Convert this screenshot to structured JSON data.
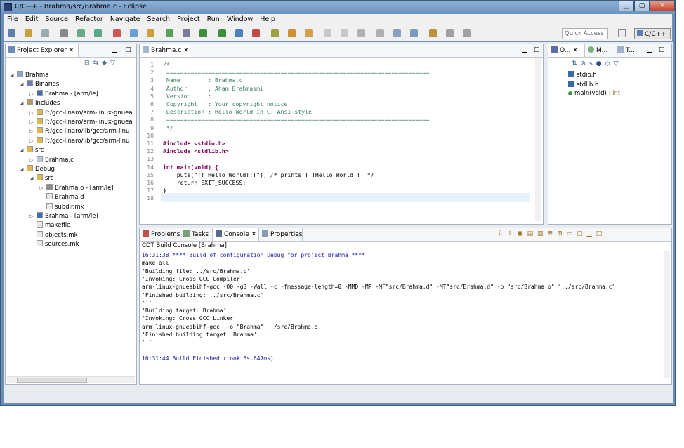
{
  "window": {
    "title": "C/C++ - Brahma/src/Brahma.c - Eclipse"
  },
  "menu": [
    "File",
    "Edit",
    "Source",
    "Refactor",
    "Navigate",
    "Search",
    "Project",
    "Run",
    "Window",
    "Help"
  ],
  "toolbar": {
    "quick_access": "Quick Access",
    "perspective": "C/C++"
  },
  "explorer": {
    "tab": "Project Explorer",
    "items": [
      {
        "label": "Brahma",
        "depth": 0,
        "icon": "project-icon"
      },
      {
        "label": "Binaries",
        "depth": 1,
        "icon": "binaries-icon"
      },
      {
        "label": "Brahma - [arm/le]",
        "depth": 2,
        "icon": "binary-icon"
      },
      {
        "label": "Includes",
        "depth": 1,
        "icon": "includes-icon"
      },
      {
        "label": "F:/gcc-linaro/arm-linux-gnuea",
        "depth": 2,
        "icon": "folder-icon"
      },
      {
        "label": "F:/gcc-linaro/arm-linux-gnuea",
        "depth": 2,
        "icon": "folder-icon"
      },
      {
        "label": "F:/gcc-linaro/lib/gcc/arm-linu",
        "depth": 2,
        "icon": "folder-icon"
      },
      {
        "label": "F:/gcc-linaro/lib/gcc/arm-linu",
        "depth": 2,
        "icon": "folder-icon"
      },
      {
        "label": "src",
        "depth": 1,
        "icon": "source-folder-icon"
      },
      {
        "label": "Brahma.c",
        "depth": 2,
        "icon": "c-file-icon"
      },
      {
        "label": "Debug",
        "depth": 1,
        "icon": "folder-icon"
      },
      {
        "label": "src",
        "depth": 2,
        "icon": "folder-icon"
      },
      {
        "label": "Brahma.o - [arm/le]",
        "depth": 3,
        "icon": "object-file-icon"
      },
      {
        "label": "Brahma.d",
        "depth": 3,
        "icon": "file-icon"
      },
      {
        "label": "subdir.mk",
        "depth": 3,
        "icon": "file-icon"
      },
      {
        "label": "Brahma - [arm/le]",
        "depth": 2,
        "icon": "binary-icon"
      },
      {
        "label": "makefile",
        "depth": 2,
        "icon": "file-icon"
      },
      {
        "label": "objects.mk",
        "depth": 2,
        "icon": "file-icon"
      },
      {
        "label": "sources.mk",
        "depth": 2,
        "icon": "file-icon"
      }
    ]
  },
  "editor": {
    "tab": "Brahma.c",
    "lines": [
      {
        "n": "1",
        "text": "/*",
        "cls": "cm"
      },
      {
        "n": "2",
        "text": " ============================================================================",
        "cls": "cm"
      },
      {
        "n": "3",
        "text": " Name        : Brahma.c",
        "cls": "cm"
      },
      {
        "n": "4",
        "text": " Author      : Aham Brahmasmi",
        "cls": "cm"
      },
      {
        "n": "5",
        "text": " Version     :",
        "cls": "cm"
      },
      {
        "n": "6",
        "text": " Copyright   : Your copyright notice",
        "cls": "cm"
      },
      {
        "n": "7",
        "text": " Description : Hello World in C, Ansi-style",
        "cls": "cm"
      },
      {
        "n": "8",
        "text": " ============================================================================",
        "cls": "cm"
      },
      {
        "n": "9",
        "text": " */",
        "cls": "cm"
      },
      {
        "n": "10",
        "text": "",
        "cls": ""
      },
      {
        "n": "11",
        "text": "#include <stdio.h>",
        "cls": "kw"
      },
      {
        "n": "12",
        "text": "#include <stdlib.h>",
        "cls": "kw"
      },
      {
        "n": "13",
        "text": "",
        "cls": ""
      },
      {
        "n": "14",
        "text": "int main(void) {",
        "cls": "kw"
      },
      {
        "n": "15",
        "text": "    puts(\"!!!Hello World!!!\"); /* prints !!!Hello World!!! */",
        "cls": ""
      },
      {
        "n": "16",
        "text": "    return EXIT_SUCCESS;",
        "cls": ""
      },
      {
        "n": "17",
        "text": "}",
        "cls": ""
      },
      {
        "n": "18",
        "text": "",
        "cls": ""
      }
    ]
  },
  "outline": {
    "tabs": [
      "O...",
      "M...",
      "T..."
    ],
    "items": [
      {
        "label": "stdio.h",
        "type": ""
      },
      {
        "label": "stdlib.h",
        "type": ""
      },
      {
        "label": "main(void)",
        "type": " : int"
      }
    ]
  },
  "bottom": {
    "tabs": [
      "Problems",
      "Tasks",
      "Console",
      "Properties"
    ],
    "console_title": "CDT Build Console [Brahma]",
    "lines": [
      {
        "text": "16:31:38 **** Build of configuration Debug for project Brahma ****",
        "blue": true
      },
      {
        "text": "make all",
        "blue": false
      },
      {
        "text": "'Building file: ../src/Brahma.c'",
        "blue": false
      },
      {
        "text": "'Invoking: Cross GCC Compiler'",
        "blue": false
      },
      {
        "text": "arm-linux-gnueabihf-gcc -O0 -g3 -Wall -c -fmessage-length=0 -MMD -MP -MF\"src/Brahma.d\" -MT\"src/Brahma.d\" -o \"src/Brahma.o\" \"../src/Brahma.c\"",
        "blue": false
      },
      {
        "text": "'Finished building: ../src/Brahma.c'",
        "blue": false
      },
      {
        "text": "' '",
        "blue": false
      },
      {
        "text": "'Building target: Brahma'",
        "blue": false
      },
      {
        "text": "'Invoking: Cross GCC Linker'",
        "blue": false
      },
      {
        "text": "arm-linux-gnueabihf-gcc  -o \"Brahma\"  ./src/Brahma.o",
        "blue": false
      },
      {
        "text": "'Finished building target: Brahma'",
        "blue": false
      },
      {
        "text": "' '",
        "blue": false
      },
      {
        "text": "",
        "blue": false
      },
      {
        "text": "16:31:44 Build Finished (took 5s.647ms)",
        "blue": true
      }
    ]
  }
}
